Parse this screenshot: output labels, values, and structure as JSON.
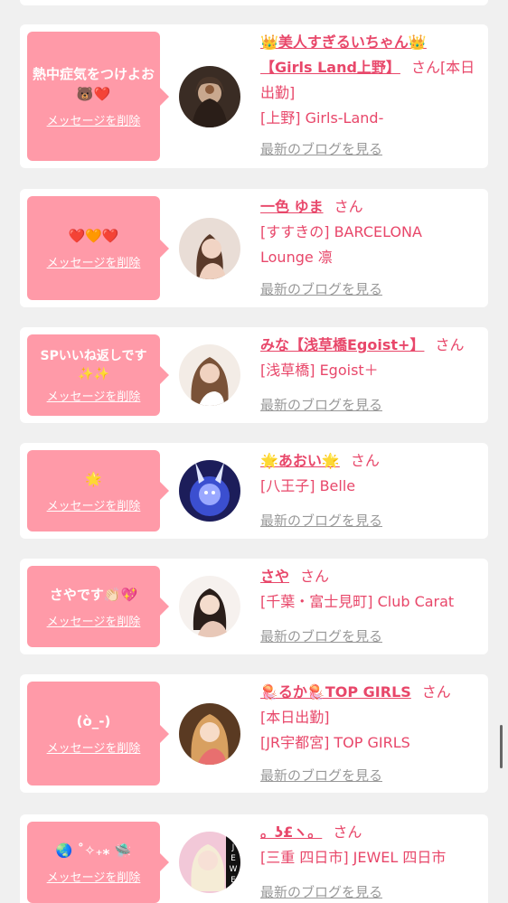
{
  "delete_label": "メッセージを削除",
  "blog_label": "最新のブログを見る",
  "san": "さん",
  "cards": [
    {
      "message": "熱中症気をつけよお🐻❤️",
      "name": "👑美人すぎるいちゃん👑【Girls Land上野】",
      "suffix": "さん[本日出勤]",
      "details": [
        "[上野] Girls-Land-"
      ]
    },
    {
      "message": "❤️🧡❤️",
      "name": "一色 ゆま",
      "suffix": "さん",
      "details": [
        "[すすきの] BARCELONA Lounge 凛"
      ]
    },
    {
      "message": "SPいいね返しです✨✨",
      "name": "みな【浅草橋Egoist+】",
      "suffix": "さん",
      "details": [
        "[浅草橋] Egoist＋"
      ]
    },
    {
      "message": "🌟",
      "name": "🌟あおい🌟",
      "suffix": "さん",
      "details": [
        "[八王子] Belle"
      ]
    },
    {
      "message": "さやです👏🏻💖",
      "name": "さや",
      "suffix": "さん",
      "details": [
        "[千葉・富士見町] Club Carat"
      ]
    },
    {
      "message": "(ò_-)",
      "name": "🪼るか🪼TOP GIRLS",
      "suffix": "さん",
      "details": [
        "[本日出勤]",
        "[JR宇都宮] TOP GIRLS"
      ]
    },
    {
      "message": "🌏 ˚✧₊⁎ 🛸",
      "name": "。ʖ£ヽ。",
      "suffix": "さん",
      "details": [
        "[三重 四日市] JEWEL 四日市"
      ]
    }
  ]
}
